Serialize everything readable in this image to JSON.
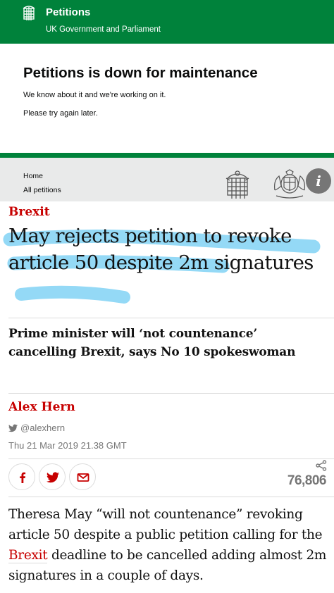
{
  "petitions": {
    "title": "Petitions",
    "subtitle": "UK Government and Parliament",
    "maintenance_title": "Petitions is down for maintenance",
    "maintenance_line1": "We know about it and we're working on it.",
    "maintenance_line2": "Please try again later.",
    "nav_home": "Home",
    "nav_all": "All petitions",
    "info_label": "i",
    "colors": {
      "green": "#00823b",
      "band": "#e9eaea"
    },
    "icons": [
      "portcullis-icon",
      "royal-coat-of-arms-icon",
      "info-icon"
    ]
  },
  "article": {
    "kicker": "Brexit",
    "headline": "May rejects petition to revoke article 50 despite 2m signatures",
    "standfirst": "Prime minister will ‘not countenance’ cancelling Brexit, says No 10 spokeswoman",
    "author": "Alex Hern",
    "twitter_handle": "@alexhern",
    "dateline": "Thu 21 Mar 2019 21.38 GMT",
    "share_count": "76,806",
    "share_icons": [
      "facebook-icon",
      "twitter-icon",
      "email-icon",
      "share-icon"
    ],
    "body_before": "Theresa May “will not countenance” revoking article 50 despite a public petition calling for the ",
    "body_link": "Brexit",
    "body_after": " deadline to be cancelled adding almost 2m signatures in a couple of days.",
    "colors": {
      "accent": "#c70000",
      "highlight": "#5bc4f1",
      "meta": "#767676"
    }
  }
}
